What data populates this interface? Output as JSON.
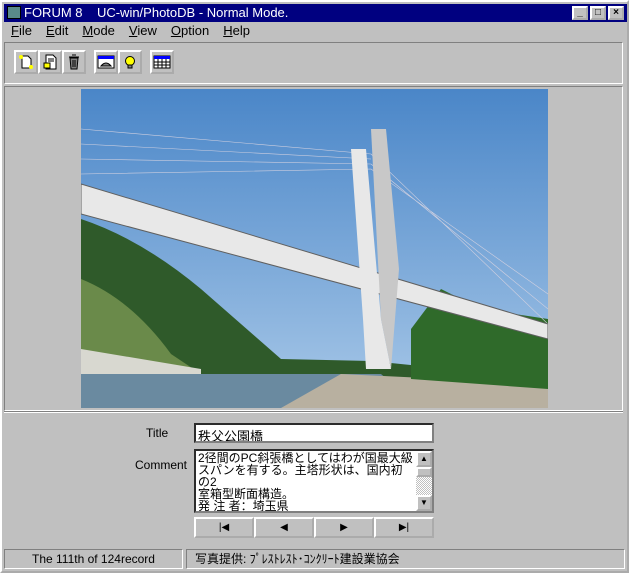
{
  "window": {
    "title": "FORUM 8    UC-win/PhotoDB - Normal Mode.",
    "minimize": "_",
    "maximize": "□",
    "close": "×"
  },
  "menu": [
    {
      "label": "File",
      "u": "F",
      "rest": "ile"
    },
    {
      "label": "Edit",
      "u": "E",
      "rest": "dit"
    },
    {
      "label": "Mode",
      "u": "M",
      "rest": "ode"
    },
    {
      "label": "View",
      "u": "V",
      "rest": "iew"
    },
    {
      "label": "Option",
      "u": "O",
      "rest": "ption"
    },
    {
      "label": "Help",
      "u": "H",
      "rest": "elp"
    }
  ],
  "toolbar": [
    "new-icon",
    "edit-icon",
    "trash-icon",
    "slideshow-icon",
    "lightbulb-icon",
    "table-icon"
  ],
  "form": {
    "title_label": "Title",
    "title_value": "秩父公園橋",
    "comment_label": "Comment",
    "comment_value": "2径間のPC斜張橋としてはわが国最大級\nスパンを有する。主塔形状は、国内初の2\n室箱型断面構造。\n発 注 者：埼玉県"
  },
  "nav": {
    "first": "|◀",
    "prev": "◀",
    "next": "▶",
    "last": "▶|"
  },
  "status": {
    "record": "The 111th of 124record",
    "credit": "写真提供: ﾌﾟﾚｽﾄﾚｽﾄ･ｺﾝｸﾘｰﾄ建設業協会"
  }
}
